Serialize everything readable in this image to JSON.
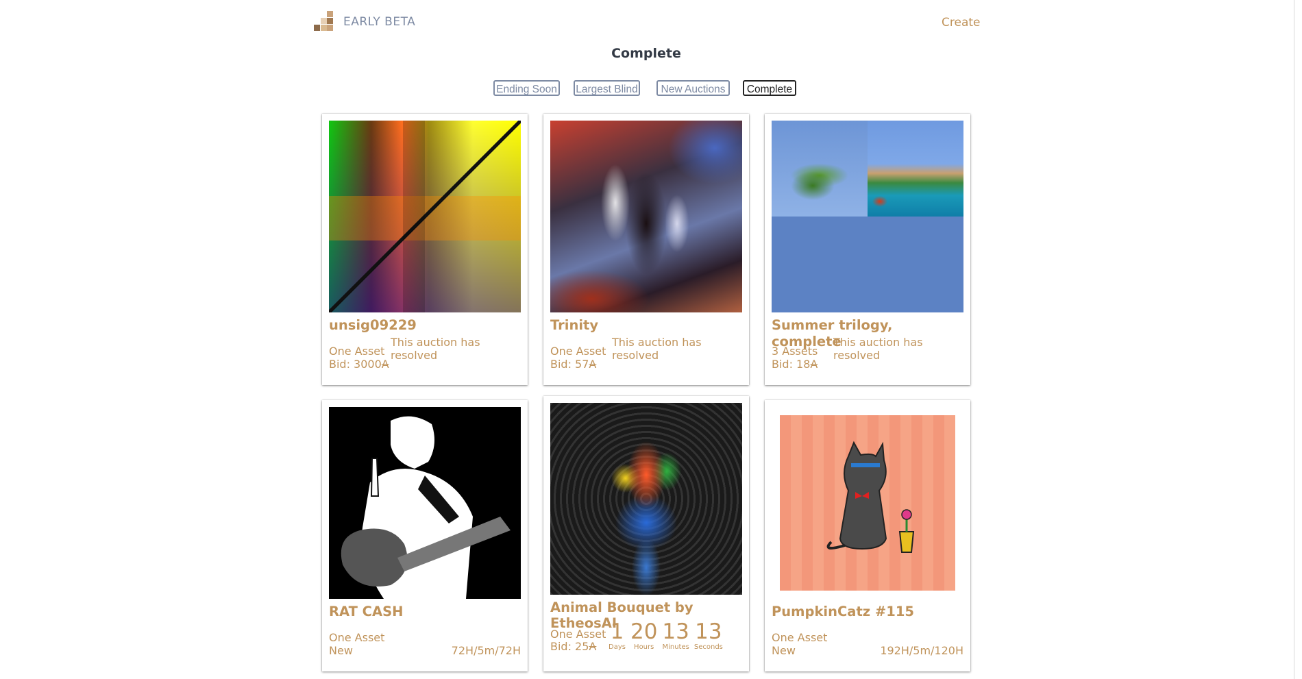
{
  "header": {
    "brand": "EARLY BETA",
    "create_label": "Create",
    "logo_colors": [
      "#a07850",
      "#c9a27a",
      "#e6cfb4",
      "#8c6a4a",
      "#d9b990"
    ]
  },
  "page": {
    "title": "Complete"
  },
  "tabs": [
    {
      "label": "Ending Soon",
      "active": false
    },
    {
      "label": "Largest Blind",
      "active": false
    },
    {
      "label": "New Auctions",
      "active": false
    },
    {
      "label": "Complete",
      "active": true
    }
  ],
  "cards": [
    {
      "title": "unsig09229",
      "assets": "One Asset",
      "bid": "Bid: 3000",
      "currency": "A",
      "status": "This auction has resolved"
    },
    {
      "title": "Trinity",
      "assets": "One Asset",
      "bid": "Bid: 57",
      "currency": "A",
      "status": "This auction has resolved"
    },
    {
      "title": "Summer trilogy, complete",
      "assets": "3 Assets",
      "bid": "Bid: 18",
      "currency": "A",
      "status": "This auction has resolved"
    },
    {
      "title": "RAT CASH",
      "assets": "One Asset",
      "state": "New",
      "schedule": "72H/5m/72H"
    },
    {
      "title": "Animal Bouquet by EtheosAI",
      "assets": "One Asset",
      "bid": "Bid: 25",
      "currency": "A",
      "countdown": [
        {
          "value": "1",
          "label": "Days"
        },
        {
          "value": "20",
          "label": "Hours"
        },
        {
          "value": "13",
          "label": "Minutes"
        },
        {
          "value": "13",
          "label": "Seconds"
        }
      ]
    },
    {
      "title": "PumpkinCatz #115",
      "assets": "One Asset",
      "state": "New",
      "schedule": "192H/5m/120H"
    }
  ]
}
